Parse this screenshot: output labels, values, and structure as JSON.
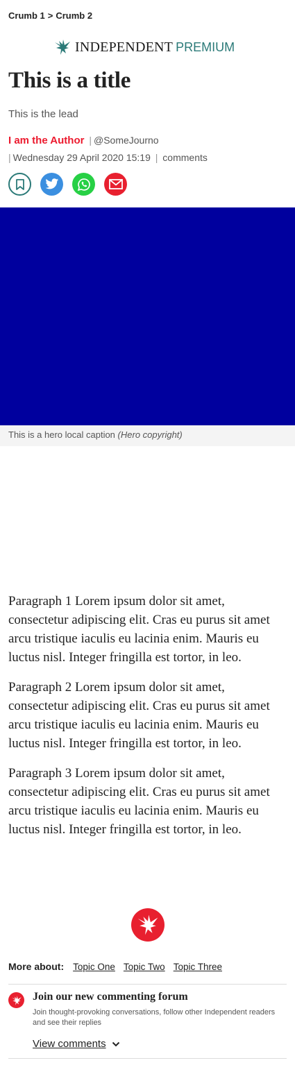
{
  "breadcrumb": {
    "items": [
      "Crumb 1",
      "Crumb 2"
    ],
    "separator": ">"
  },
  "brand": {
    "name": "INDEPENDENT",
    "tier": "PREMIUM",
    "accent": "#2b7a78",
    "logo_icon": "eagle-icon"
  },
  "article": {
    "title": "This is a title",
    "lead": "This is the lead",
    "author": "I am the Author",
    "handle": "@SomeJourno",
    "date": "Wednesday 29 April 2020 15:19",
    "comments_label": "comments",
    "hero_caption": "This is a hero local caption",
    "hero_copyright": "(Hero copyright)",
    "hero_color": "#00009e",
    "paragraphs": [
      "Paragraph 1 Lorem ipsum dolor sit amet, consectetur adipiscing elit. Cras eu purus sit amet arcu tristique iaculis eu lacinia enim. Mauris eu luctus nisl. Integer fringilla est tortor, in leo.",
      "Paragraph 2 Lorem ipsum dolor sit amet, consectetur adipiscing elit. Cras eu purus sit amet arcu tristique iaculis eu lacinia enim. Mauris eu luctus nisl. Integer fringilla est tortor, in leo.",
      "Paragraph 3 Lorem ipsum dolor sit amet, consectetur adipiscing elit. Cras eu purus sit amet arcu tristique iaculis eu lacinia enim. Mauris eu luctus nisl. Integer fringilla est tortor, in leo."
    ]
  },
  "share": {
    "buttons": [
      "bookmark-icon",
      "twitter-icon",
      "whatsapp-icon",
      "email-icon"
    ],
    "colors": {
      "bookmark": "#2b7a78",
      "twitter": "#3b8fe0",
      "whatsapp": "#27d045",
      "email": "#e8202f"
    }
  },
  "more_about": {
    "label": "More about:",
    "topics": [
      "Topic One",
      "Topic Two",
      "Topic Three"
    ]
  },
  "comments_forum": {
    "title": "Join our new commenting forum",
    "subtitle": "Join thought-provoking conversations, follow other Independent readers and see their replies",
    "view_label": "View comments"
  },
  "colors": {
    "author": "#ec1a2e",
    "brand_red": "#e8202f"
  }
}
